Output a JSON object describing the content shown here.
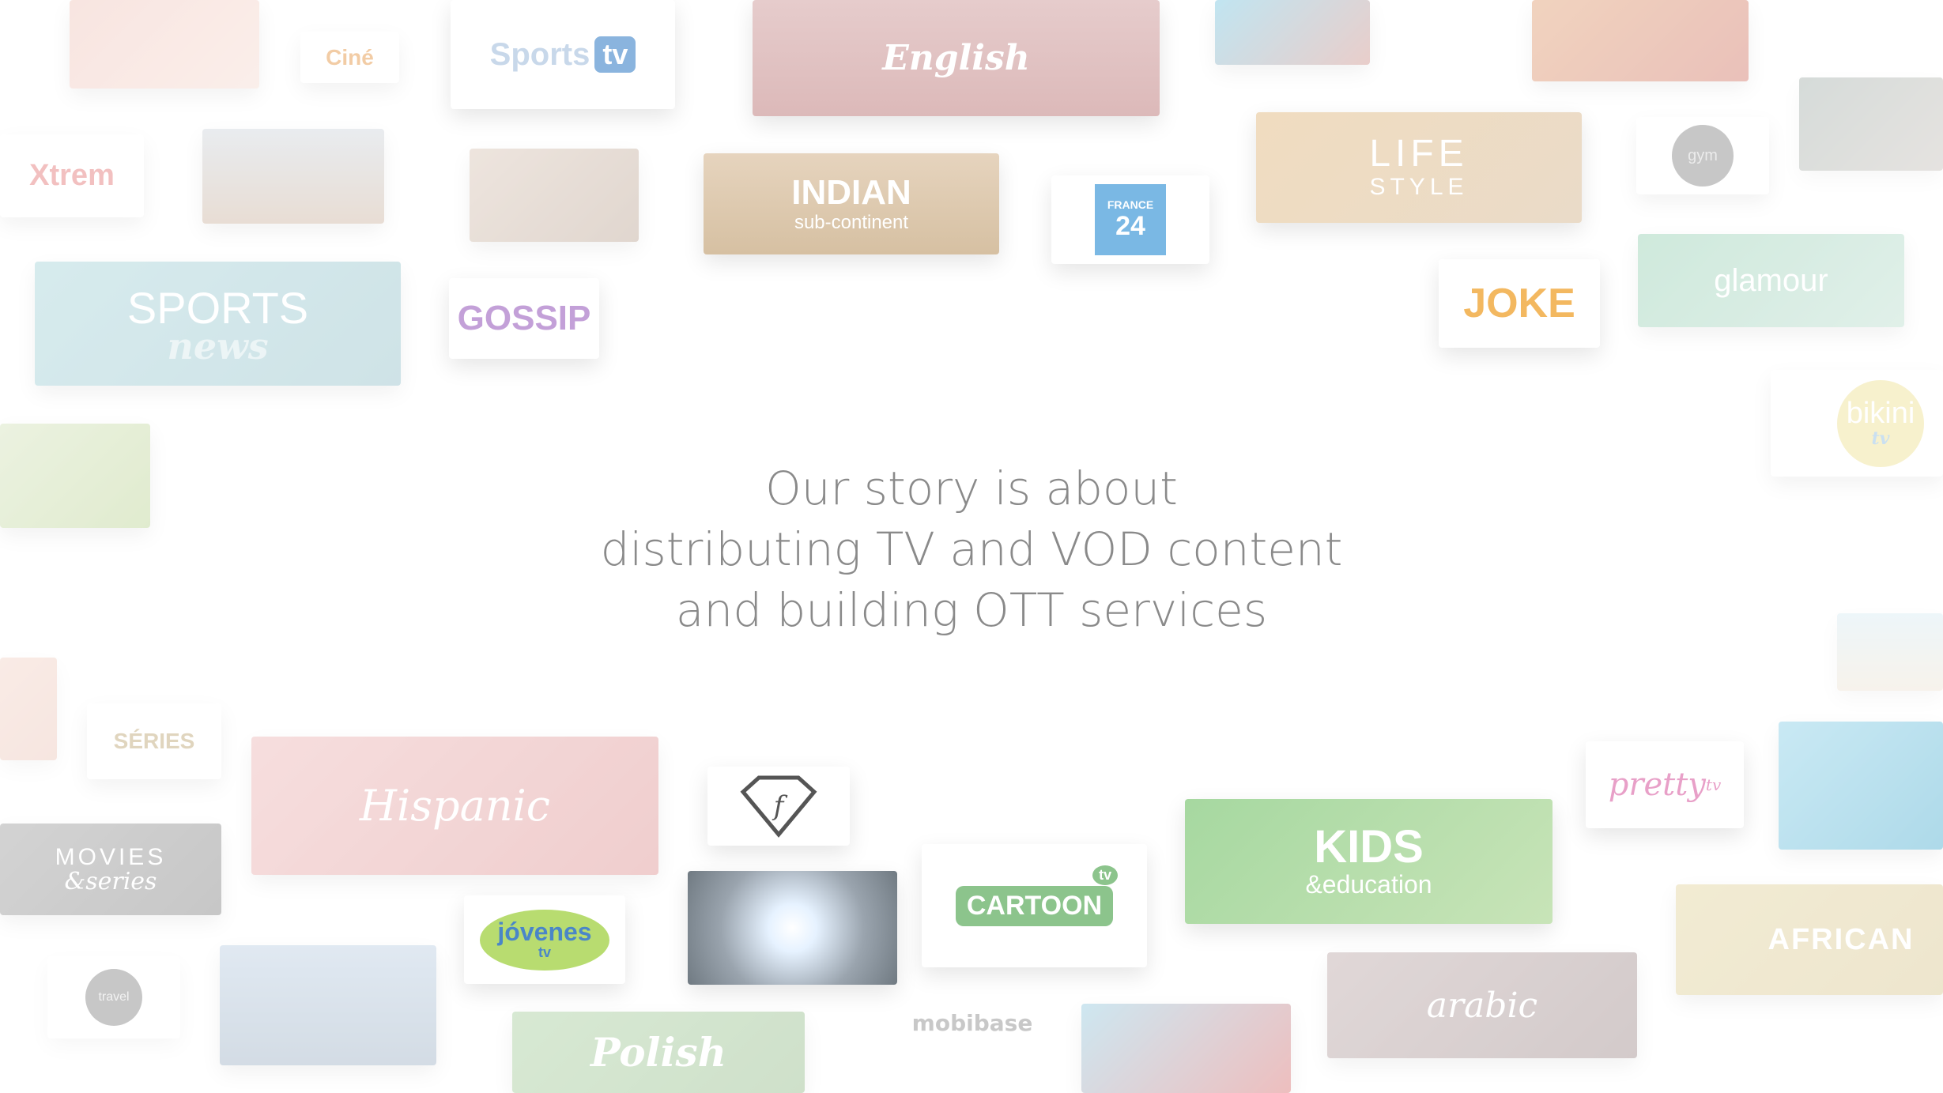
{
  "headline": {
    "line1": "Our story is about",
    "line2": "distributing TV and VOD content",
    "line3": "and building OTT services"
  },
  "watermark": "mobibase",
  "tiles": {
    "sports_tv": {
      "text1": "Sports",
      "text2": "tv"
    },
    "english": "English",
    "indian": {
      "text1": "INDIAN",
      "text2": "sub-continent"
    },
    "france24": {
      "text1": "FRANCE",
      "text2": "24"
    },
    "lifestyle": {
      "text1": "LIFE",
      "text2": "STYLE"
    },
    "joke": "JOKE",
    "glamour": "glamour",
    "bikini": {
      "text1": "bikini",
      "text2": "tv"
    },
    "sports_news": {
      "text1": "SPORTS",
      "text2": "news"
    },
    "gossip": "GOSSIP",
    "xtrem": "Xtrem",
    "cine": "Ciné",
    "series": "SÉRIES",
    "hispanic": "Hispanic",
    "fashion": "f",
    "cartoon": {
      "text1": "CARTOON",
      "text2": "tv"
    },
    "kids": {
      "text1": "KIDS",
      "text2": "&education"
    },
    "pretty": {
      "text1": "pretty",
      "text2": "tv"
    },
    "african": "AFRICAN",
    "arabic": "arabic",
    "polish": "Polish",
    "jovenes": {
      "text1": "jóvenes",
      "text2": "tv"
    },
    "movies": {
      "text1": "MOVIES",
      "text2": "&series"
    },
    "travel": "travel",
    "gym": "gym"
  },
  "colors": {
    "headline": "#8a8a8a",
    "sports_tv_accent": "#8ab4de",
    "france24": "#2e8fd1",
    "kids_green": "#79b87a",
    "cartoon_green": "#5aa85b"
  }
}
